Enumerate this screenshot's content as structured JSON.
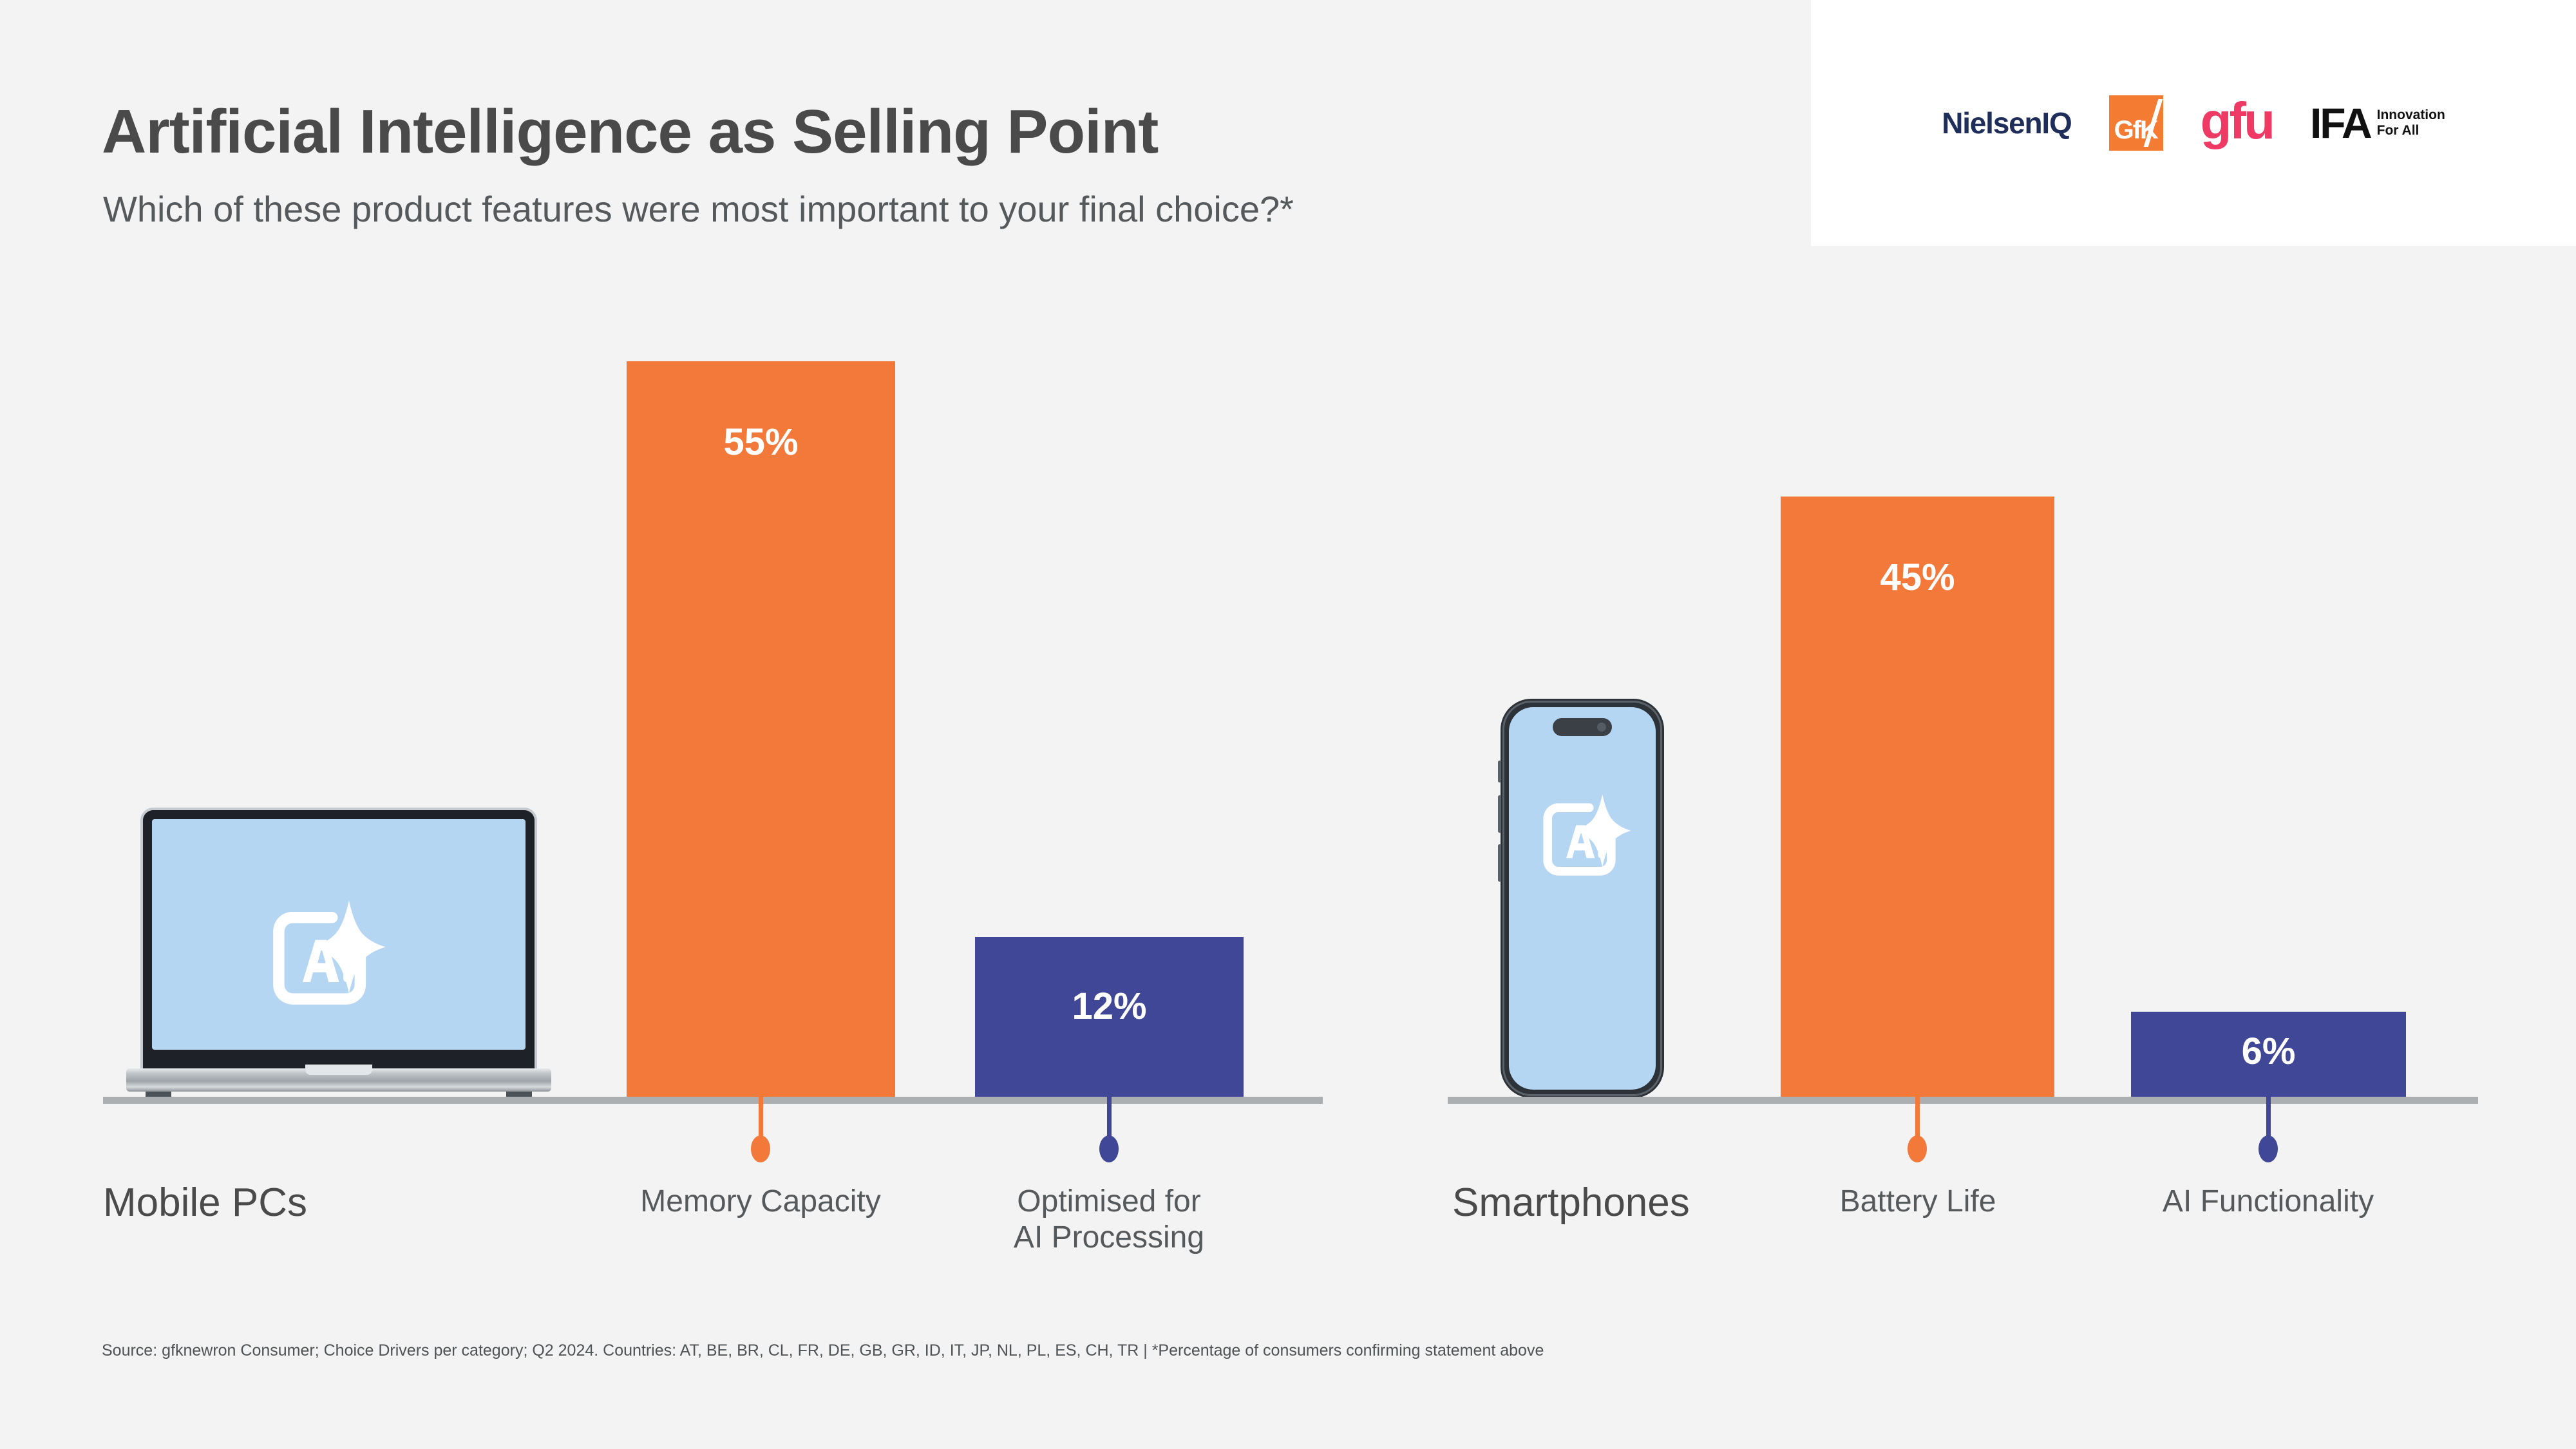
{
  "header": {
    "title": "Artificial Intelligence as Selling Point",
    "subtitle": "Which of these product features were most important to your final choice?*"
  },
  "logos": {
    "nielseniq": "NielsenIQ",
    "gfk": "GfK",
    "gfu": "gfu",
    "ifa": "IFA",
    "ifa_tagline_line1": "Innovation",
    "ifa_tagline_line2": "For All"
  },
  "source": "Source: gfknewron Consumer; Choice Drivers per category; Q2 2024. Countries: AT, BE, BR, CL, FR, DE, GB, GR, ID, IT, JP, NL, PL, ES, CH, TR | *Percentage of consumers confirming statement above",
  "devices": {
    "mobile_pcs": {
      "label": "Mobile PCs",
      "glyph": "Ai"
    },
    "smartphones": {
      "label": "Smartphones",
      "glyph": "Ai"
    }
  },
  "colors": {
    "orange": "#F2793A",
    "blue": "#3F4796",
    "axis": "#ACAFB2",
    "background": "#F2F3F2",
    "screen_blue": "#B5D6F2",
    "title_grey": "#4A4A4A",
    "gfu_pink": "#EE3A64",
    "gfk_orange": "#F47B32",
    "niq_navy": "#1F2D5A"
  },
  "chart_data": {
    "type": "bar",
    "title": "Artificial Intelligence as Selling Point",
    "subtitle": "Which of these product features were most important to your final choice?*",
    "xlabel": "",
    "ylabel": "",
    "ylim": [
      0,
      60
    ],
    "grid": false,
    "legend": "none",
    "value_suffix": "%",
    "groups": [
      {
        "name": "Mobile PCs",
        "categories": [
          "Memory Capacity",
          "Optimised for AI Processing"
        ],
        "values": [
          55,
          12
        ],
        "value_labels": [
          "55%",
          "12%"
        ],
        "colors": [
          "#F2793A",
          "#3F4796"
        ]
      },
      {
        "name": "Smartphones",
        "categories": [
          "Battery Life",
          "AI Functionality"
        ],
        "values": [
          45,
          6
        ],
        "value_labels": [
          "45%",
          "6%"
        ],
        "colors": [
          "#F2793A",
          "#3F4796"
        ]
      }
    ]
  },
  "bars": {
    "mpc_memory": {
      "label": "Memory Capacity",
      "value": "55%"
    },
    "mpc_ai": {
      "label_line1": "Optimised for",
      "label_line2": "AI Processing",
      "value": "12%"
    },
    "sp_battery": {
      "label": "Battery Life",
      "value": "45%"
    },
    "sp_ai": {
      "label": "AI Functionality",
      "value": "6%"
    }
  }
}
